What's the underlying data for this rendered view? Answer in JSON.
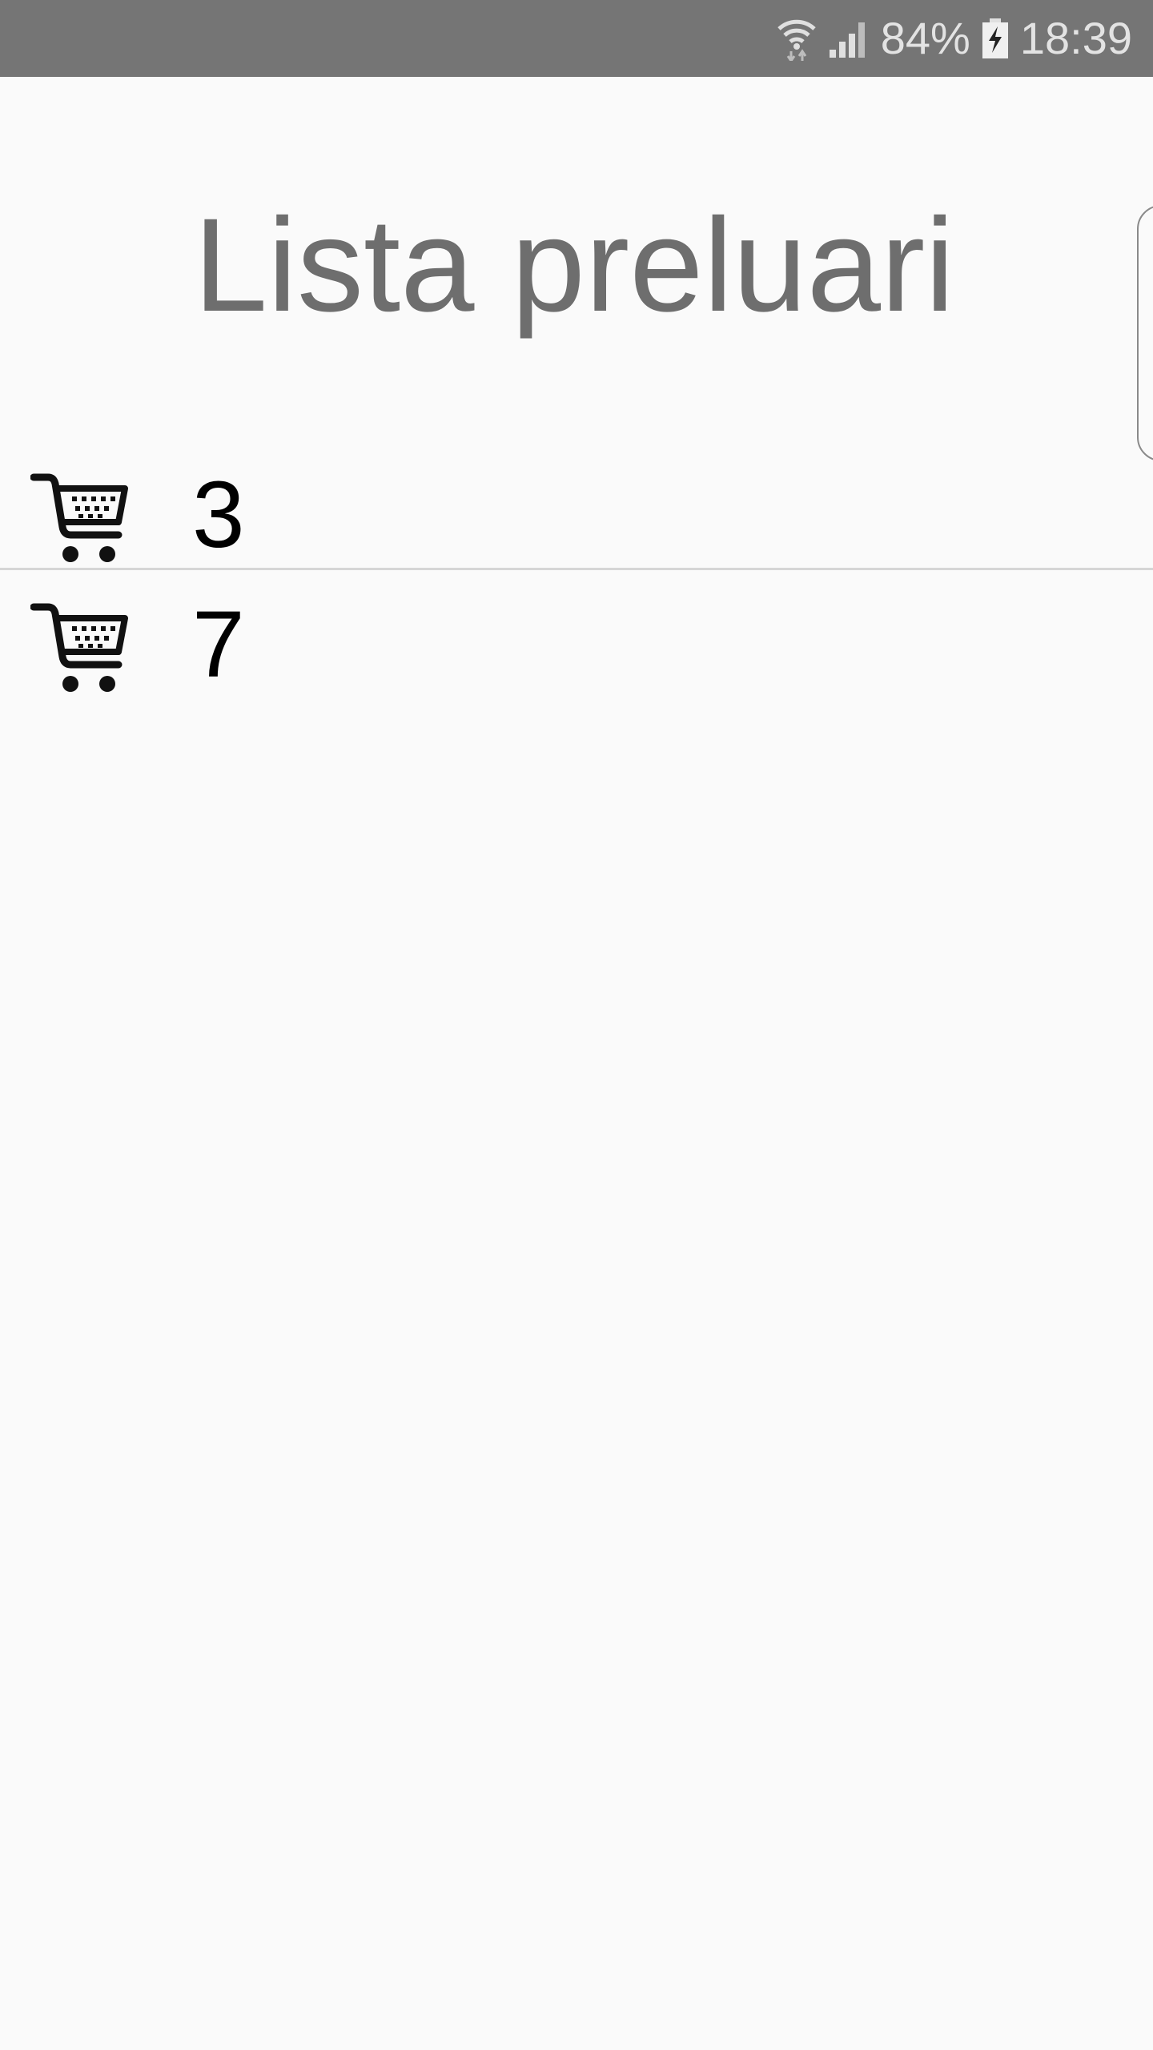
{
  "status_bar": {
    "battery_percent": "84%",
    "time": "18:39",
    "icons": [
      "wifi-icon",
      "signal-icon",
      "battery-charging-icon"
    ]
  },
  "page": {
    "title": "Lista preluari"
  },
  "list": {
    "items": [
      {
        "label": "3",
        "icon": "cart-icon"
      },
      {
        "label": "7",
        "icon": "cart-icon"
      }
    ]
  },
  "colors": {
    "status_bar": "#757575",
    "background": "#fafafa",
    "title": "#6e6e6e",
    "divider": "#d6d6d6"
  }
}
